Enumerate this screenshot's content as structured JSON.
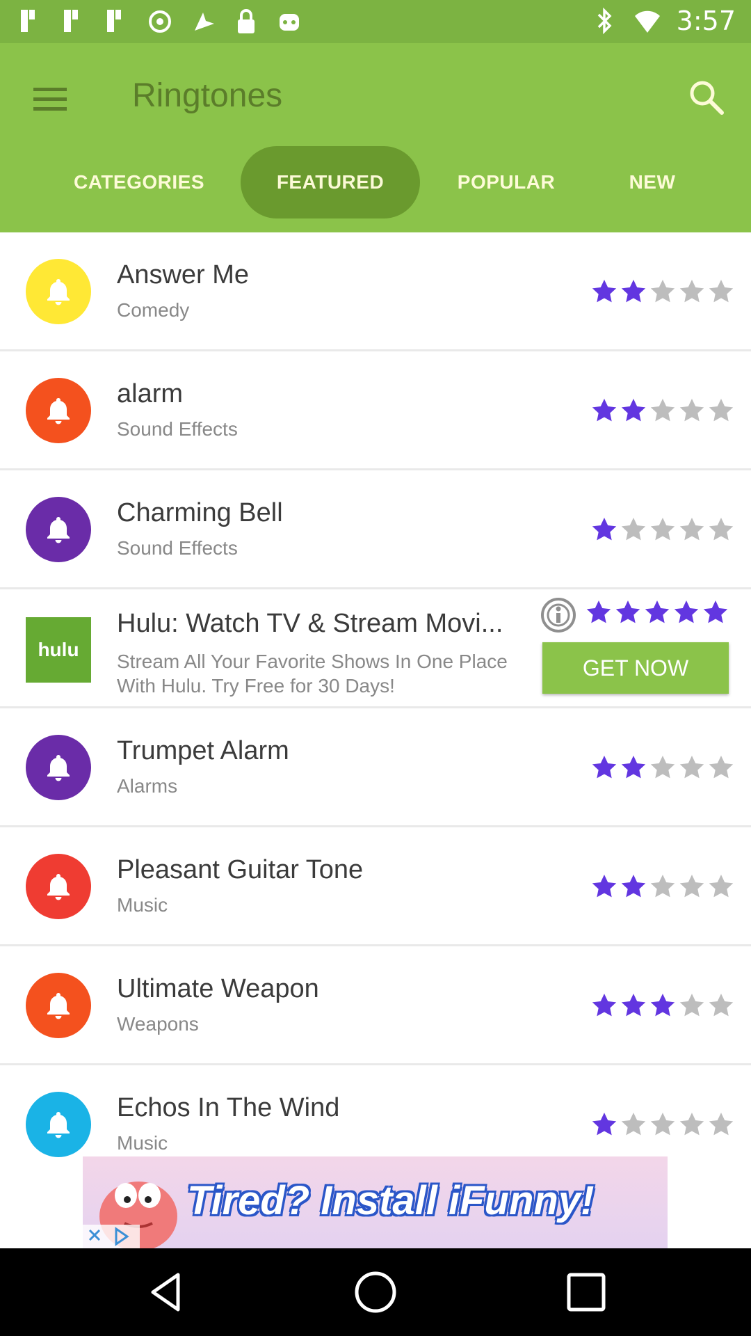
{
  "status_bar": {
    "time": "3:57",
    "left_icons": [
      "slack-icon",
      "slack-icon",
      "slack-icon",
      "vpn-key-icon",
      "fake-gps-icon",
      "lock-icon",
      "android-icon"
    ],
    "right_icons": [
      "bluetooth-icon",
      "wifi-icon"
    ]
  },
  "app_bar": {
    "title": "Ringtones",
    "tabs": [
      {
        "label": "CATEGORIES",
        "active": false
      },
      {
        "label": "FEATURED",
        "active": true
      },
      {
        "label": "POPULAR",
        "active": false
      },
      {
        "label": "NEW",
        "active": false
      }
    ]
  },
  "ringtones": [
    {
      "title": "Answer Me",
      "category": "Comedy",
      "rating": 2,
      "icon_color": "#ffe835"
    },
    {
      "title": "alarm",
      "category": "Sound Effects",
      "rating": 2,
      "icon_color": "#f4511e"
    },
    {
      "title": "Charming Bell",
      "category": "Sound Effects",
      "rating": 1,
      "icon_color": "#6a2ca8"
    },
    {
      "title": "Trumpet Alarm",
      "category": "Alarms",
      "rating": 2,
      "icon_color": "#6a2ca8"
    },
    {
      "title": "Pleasant Guitar Tone",
      "category": "Music",
      "rating": 2,
      "icon_color": "#ef3c32"
    },
    {
      "title": "Ultimate Weapon",
      "category": "Weapons",
      "rating": 3,
      "icon_color": "#f4511e"
    },
    {
      "title": "Echos In The Wind",
      "category": "Music",
      "rating": 1,
      "icon_color": "#1ab3e6"
    }
  ],
  "ad": {
    "logo_text": "hulu",
    "title": "Hulu: Watch TV & Stream Movi...",
    "body": "Stream All Your Favorite Shows In One Place With Hulu. Try Free for 30 Days!",
    "rating": 5,
    "cta": "GET NOW"
  },
  "banner": {
    "text": "Tired? Install iFunny!"
  },
  "colors": {
    "status_bar": "#7cb342",
    "app_bar": "#8bc34a",
    "tab_active": "#6a9a2e",
    "star_filled": "#6236e0",
    "star_empty": "#bdbdbd"
  }
}
